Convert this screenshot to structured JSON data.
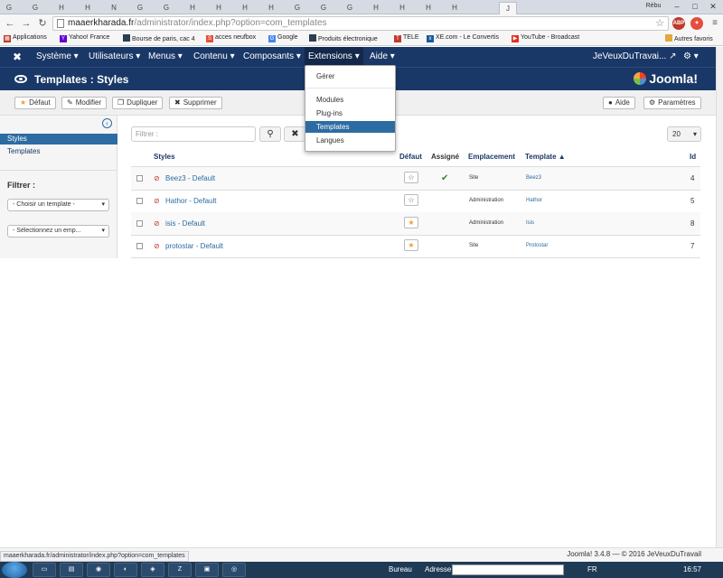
{
  "browser": {
    "tabs": [
      "G",
      "G",
      "H",
      "H",
      "N",
      "G",
      "G",
      "H",
      "H",
      "H",
      "H",
      "G",
      "G",
      "G",
      "H",
      "H",
      "H",
      "H",
      "J"
    ],
    "window_user": "Rébu",
    "url_host": "maaerkharada.fr",
    "url_path": "/administrator/index.php?option=com_templates",
    "ext1": "ABP"
  },
  "bookmarks": [
    {
      "label": "Applications",
      "color": "#c0392b"
    },
    {
      "label": "Yahoo! France",
      "color": "#6001d2"
    },
    {
      "label": "Bourse de paris, cac 4",
      "color": "#2c3e50"
    },
    {
      "label": "acces neufbox",
      "color": "#e74c3c"
    },
    {
      "label": "Google",
      "color": "#4285f4"
    },
    {
      "label": "Produits électronique",
      "color": "#2c3e50"
    },
    {
      "label": "TELE",
      "color": "#c0392b"
    },
    {
      "label": "XE.com - Le Convertis",
      "color": "#1a5a96"
    },
    {
      "label": "YouTube - Broadcast",
      "color": "#e52d27"
    },
    {
      "label": "Autres favoris",
      "color": "#e1a93b"
    }
  ],
  "nav": {
    "menus": [
      "Système",
      "Utilisateurs",
      "Menus",
      "Contenu",
      "Composants",
      "Extensions",
      "Aide"
    ],
    "user": "JeVeuxDuTravai...",
    "gear": "⚙"
  },
  "title": "Templates : Styles",
  "logo": "Joomla!",
  "toolbar": {
    "default": "Défaut",
    "edit": "Modifier",
    "duplicate": "Dupliquer",
    "delete": "Supprimer",
    "help": "Aide",
    "params": "Paramètres"
  },
  "sidebar": {
    "items": [
      "Styles",
      "Templates"
    ],
    "filter_label": "Filtrer :",
    "select_template": "- Choisir un template -",
    "select_location": "- Sélectionnez un emp..."
  },
  "filter": {
    "placeholder": "Filtrer :",
    "limit": "20"
  },
  "table": {
    "headers": {
      "styles": "Styles",
      "default": "Défaut",
      "assigned": "Assigné",
      "location": "Emplacement",
      "template": "Template ▲",
      "id": "Id"
    },
    "rows": [
      {
        "name": "Beez3 - Default",
        "assigned": "✔",
        "location": "Site",
        "template": "Beez3",
        "id": "4",
        "default_active": false
      },
      {
        "name": "Hathor - Default",
        "assigned": "",
        "location": "Administration",
        "template": "Hathor",
        "id": "5",
        "default_active": false
      },
      {
        "name": "isis - Default",
        "assigned": "",
        "location": "Administration",
        "template": "Isis",
        "id": "8",
        "default_active": true
      },
      {
        "name": "protostar - Default",
        "assigned": "",
        "location": "Site",
        "template": "Protostar",
        "id": "7",
        "default_active": true
      }
    ]
  },
  "dropdown": {
    "items": [
      "Gérer",
      "Modules",
      "Plug-ins",
      "Templates",
      "Langues"
    ]
  },
  "footer": {
    "version": "Joomla! 3.4.8 — © 2016 JeVeuxDuTravail",
    "status_url": "maaerkharada.fr/administrator/index.php?option=com_templates"
  },
  "taskbar": {
    "bureau": "Bureau",
    "adresse": "Adresse",
    "lang": "FR",
    "time": "16:57"
  },
  "colors": {
    "nav_bg": "#1a3867",
    "highlight": "#2d6ca2",
    "assigned": "#2e8b2e",
    "star_active": "#e9a23b"
  }
}
